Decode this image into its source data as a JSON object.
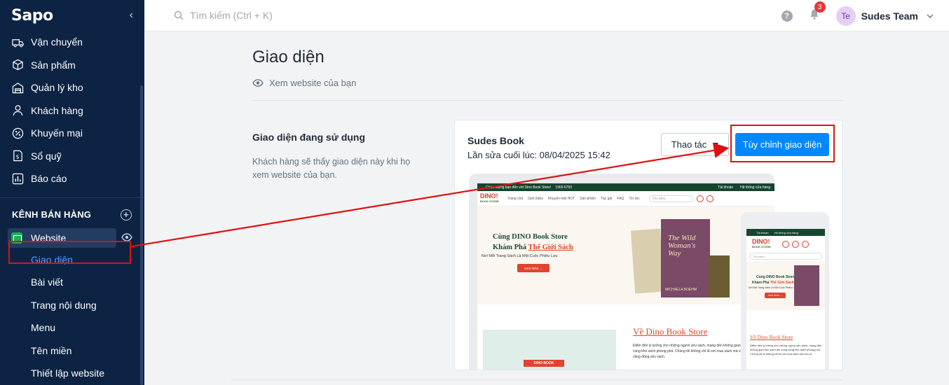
{
  "sidebar": {
    "logo": "Sapo",
    "items": [
      {
        "label": "Vận chuyển",
        "icon": "truck-icon"
      },
      {
        "label": "Sản phẩm",
        "icon": "box-icon"
      },
      {
        "label": "Quản lý kho",
        "icon": "warehouse-icon"
      },
      {
        "label": "Khách hàng",
        "icon": "user-icon"
      },
      {
        "label": "Khuyến mại",
        "icon": "percent-icon"
      },
      {
        "label": "Sổ quỹ",
        "icon": "cashbook-icon"
      },
      {
        "label": "Báo cáo",
        "icon": "chart-icon"
      }
    ],
    "section_title": "KÊNH BÁN HÀNG",
    "website_label": "Website",
    "sub_items": [
      "Giao diện",
      "Bài viết",
      "Trang nội dung",
      "Menu",
      "Tên miền",
      "Thiết lập website"
    ],
    "active_sub": "Giao diện"
  },
  "topbar": {
    "search_placeholder": "Tìm kiếm (Ctrl + K)",
    "notification_count": "3",
    "avatar_initials": "Te",
    "user_name": "Sudes Team"
  },
  "main": {
    "title": "Giao diện",
    "view_site": "Xem website của bạn",
    "section_title": "Giao diện đang sử dụng",
    "section_desc": "Khách hàng sẽ thấy giao diện này khi họ xem website của bạn.",
    "theme_name": "Sudes Book",
    "last_edited": "Lần sửa cuối lúc: 08/04/2025 15:42",
    "actions_label": "Thao tác",
    "customize_label": "Tùy chỉnh giao diện"
  },
  "preview": {
    "topbar_text": "Chào mừng bạn đến với Dino Book Store!",
    "hotline": "1900 6750",
    "account": "Tài khoản",
    "stores": "Hệ thống cửa hàng",
    "logo": "DINO!",
    "logo_sub": "BOOK STORE",
    "nav": [
      "Trang chủ",
      "Giới thiệu",
      "Khuyến mãi HOT",
      "Sản phẩm",
      "Tác giả",
      "FAQ",
      "Tin tức"
    ],
    "search": "Tìm kiếm...",
    "hero_line1": "Cùng DINO Book Store",
    "hero_line2a": "Khám Phá",
    "hero_line2b": "Thế Giới Sách",
    "hero_line3": "Nơi Mỗi Trang Sách Là Một Cuộc Phiêu Lưu",
    "hero_button": "Xem thêm →",
    "book_title": "The Wild Woman's Way",
    "book_author": "MICHAELA BOEHM",
    "about_title": "Về Dino Book Store",
    "about_text": "Điểm đến lý tưởng cho những người yêu sách, mang đến không gian đọc sách ấm cúng cùng kho sách phong phú. Chúng tôi không chỉ là nơi mua sách mà còn là điểm hẹn của cộng đồng yêu sách.",
    "sign": "DINO BOOK",
    "mobile_about_title": "Về Dino Book Store",
    "mobile_about_text": "Điểm đến lý tưởng cho những người yêu sách, mang đến không gian đọc sách ấm cúng cùng kho sách phong phú. Chúng mình không chỉ là nơi mua sách mà còn là"
  },
  "colors": {
    "sidebar_bg": "#0d2343",
    "primary": "#0088ff",
    "annotation": "#e01010",
    "active_link": "#3ea6ff"
  }
}
